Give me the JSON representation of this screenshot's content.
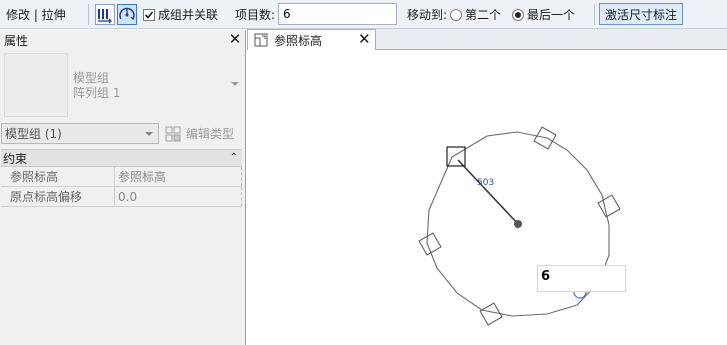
{
  "options_bar": {
    "modify_label": "修改 | 拉伸",
    "group_checkbox_label": "成组并关联",
    "group_checked": true,
    "count_label": "项目数:",
    "count_value": "6",
    "move_to_label": "移动到:",
    "option_second": "第二个",
    "option_last": "最后一个",
    "selected_option": "最后一个",
    "activate_label": "激活尺寸标注"
  },
  "properties": {
    "title": "属性",
    "close_symbol": "✕",
    "type_family": "模型组",
    "type_name": "阵列组 1",
    "instance_select": "模型组 (1)",
    "edit_type_label": "编辑类型",
    "section_title": "约束",
    "section_toggle": "⌃",
    "rows": [
      {
        "label": "参照标高",
        "value": "参照标高"
      },
      {
        "label": "原点标高偏移",
        "value": "0.0"
      }
    ]
  },
  "view_tab": {
    "label": "参照标高",
    "close_symbol": "✕"
  },
  "canvas": {
    "radius_label": "503",
    "temp_dimension_value": "6"
  },
  "icons": [
    "array-linear-icon",
    "array-radial-icon",
    "view-tab-icon",
    "edit-type-icon",
    "rotation-handle-icon"
  ]
}
